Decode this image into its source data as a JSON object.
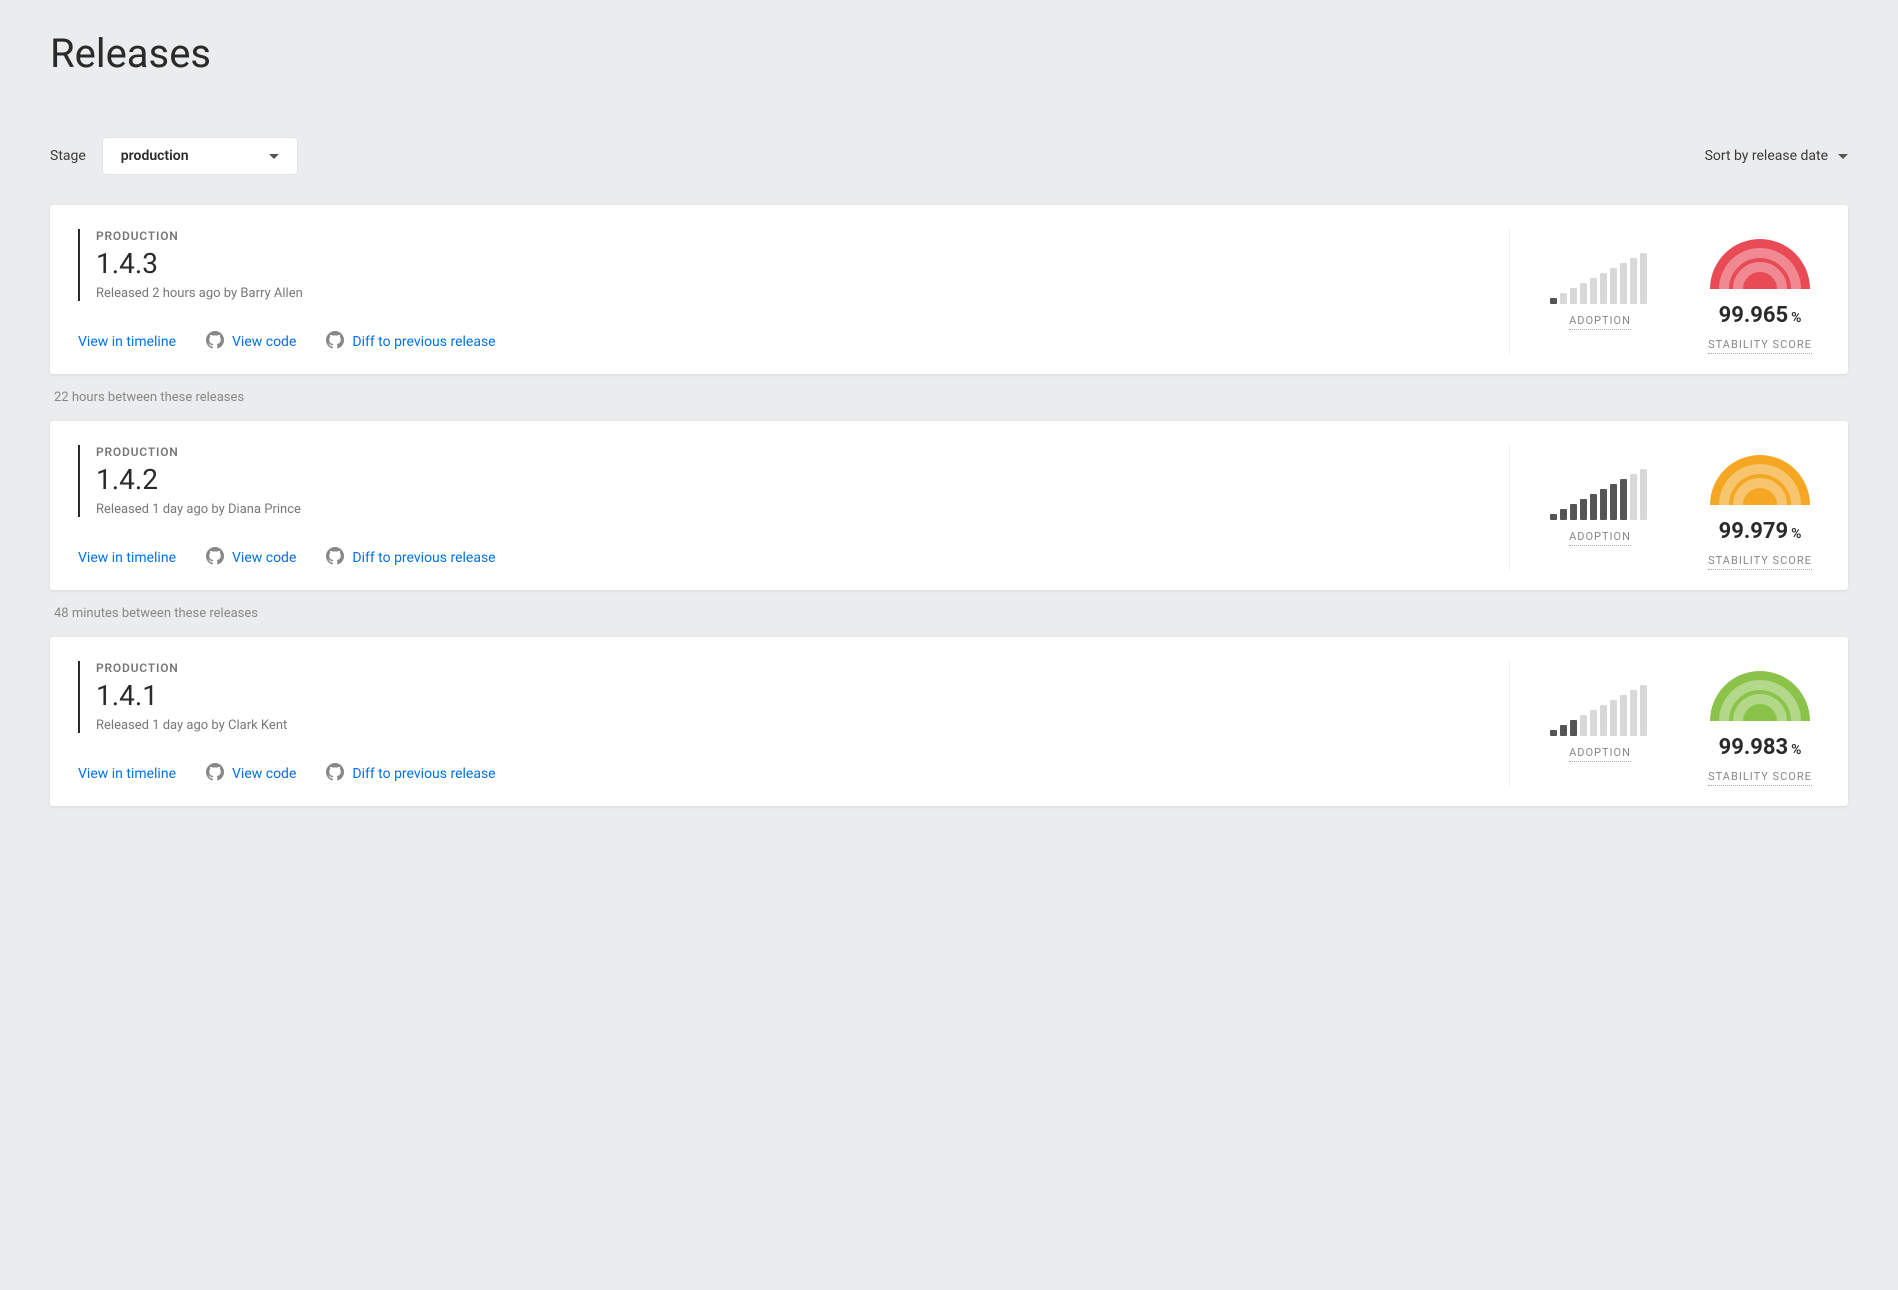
{
  "page_title": "Releases",
  "controls": {
    "stage_label": "Stage",
    "stage_value": "production",
    "sort_label": "Sort by release date"
  },
  "link_labels": {
    "timeline": "View in timeline",
    "code": "View code",
    "diff": "Diff to previous release"
  },
  "metric_labels": {
    "adoption": "ADOPTION",
    "stability": "STABILITY SCORE"
  },
  "percent_symbol": "%",
  "releases": [
    {
      "stage_tag": "PRODUCTION",
      "version": "1.4.3",
      "meta": "Released 2 hours ago by Barry Allen",
      "gauge_color": "#e94b56",
      "stability_value": "99.965",
      "adoption_active_bars": 1,
      "adoption_total_bars": 10
    },
    {
      "stage_tag": "PRODUCTION",
      "version": "1.4.2",
      "meta": "Released 1 day ago by Diana Prince",
      "gauge_color": "#f5a623",
      "stability_value": "99.979",
      "adoption_active_bars": 8,
      "adoption_total_bars": 10
    },
    {
      "stage_tag": "PRODUCTION",
      "version": "1.4.1",
      "meta": "Released 1 day ago by Clark Kent",
      "gauge_color": "#8bc34a",
      "stability_value": "99.983",
      "adoption_active_bars": 3,
      "adoption_total_bars": 10
    }
  ],
  "gaps": [
    "22 hours between these releases",
    "48 minutes between these releases"
  ]
}
